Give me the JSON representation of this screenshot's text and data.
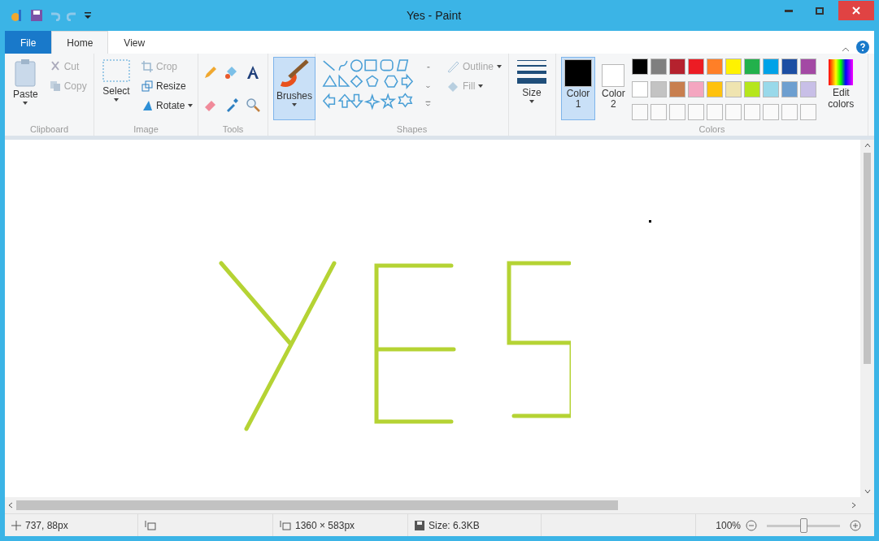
{
  "window": {
    "title": "Yes - Paint"
  },
  "tabs": [
    {
      "label": "File",
      "kind": "file",
      "selected": false
    },
    {
      "label": "Home",
      "kind": "tab",
      "selected": true
    },
    {
      "label": "View",
      "kind": "tab",
      "selected": false
    }
  ],
  "clipboard": {
    "group": "Clipboard",
    "paste": "Paste",
    "actions": [
      {
        "label": "Cut",
        "disabled": true
      },
      {
        "label": "Copy",
        "disabled": true
      }
    ]
  },
  "image": {
    "group": "Image",
    "select": "Select",
    "actions": [
      {
        "label": "Crop",
        "disabled": true
      },
      {
        "label": "Resize",
        "disabled": false
      },
      {
        "label": "Rotate",
        "disabled": false
      }
    ]
  },
  "tools": {
    "group": "Tools"
  },
  "brushes": {
    "label": "Brushes",
    "selected": true
  },
  "shapes": {
    "group": "Shapes",
    "options": [
      {
        "label": "Outline",
        "disabled": true
      },
      {
        "label": "Fill",
        "disabled": true
      }
    ]
  },
  "size": {
    "label": "Size"
  },
  "colors": {
    "group": "Colors",
    "slots": [
      {
        "label": "Color",
        "sub": "1",
        "color": "#000000",
        "selected": true
      },
      {
        "label": "Color",
        "sub": "2",
        "color": "#ffffff",
        "selected": false
      }
    ],
    "palette": [
      {
        "color": "#000000"
      },
      {
        "color": "#7f7f7f"
      },
      {
        "color": "#b5222e"
      },
      {
        "color": "#ec1c24"
      },
      {
        "color": "#ff7f27"
      },
      {
        "color": "#fff200"
      },
      {
        "color": "#22b14c"
      },
      {
        "color": "#00a2e8"
      },
      {
        "color": "#1c4ea3"
      },
      {
        "color": "#a349a4"
      },
      {
        "color": "#ffffff"
      },
      {
        "color": "#c3c3c3"
      },
      {
        "color": "#c87f4f"
      },
      {
        "color": "#f4a6c0"
      },
      {
        "color": "#ffc20e"
      },
      {
        "color": "#efe4b0"
      },
      {
        "color": "#b5e61d"
      },
      {
        "color": "#99d9ea"
      },
      {
        "color": "#6d9fd0"
      },
      {
        "color": "#c8bfe7"
      }
    ],
    "edit": "Edit colors"
  },
  "status_bar": {
    "cursor": "737, 88px",
    "canvas_size": "1360 × 583px",
    "file_size": "Size: 6.3KB",
    "zoom": "100%",
    "zoom_slider": {
      "level": 0.5
    }
  }
}
